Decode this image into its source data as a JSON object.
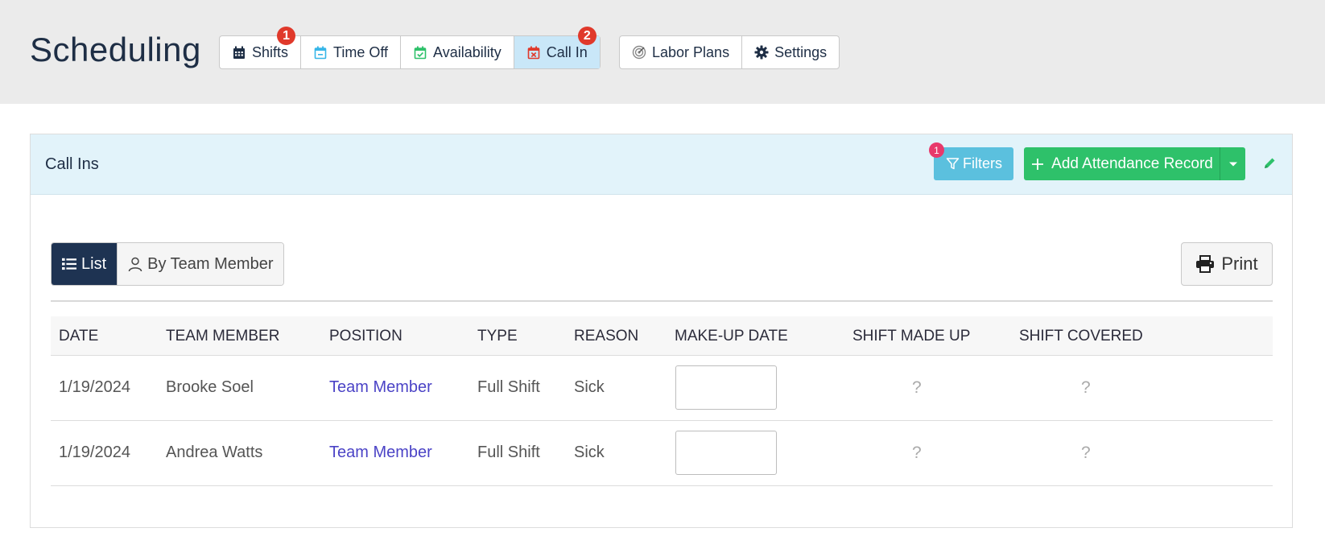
{
  "header": {
    "title": "Scheduling"
  },
  "nav": {
    "group1": [
      {
        "label": "Shifts",
        "badge": "1",
        "icon": "calendar-grid-icon",
        "color": "#1e2e45"
      },
      {
        "label": "Time Off",
        "badge": "",
        "icon": "calendar-minus-icon",
        "color": "#37b6e8"
      },
      {
        "label": "Availability",
        "badge": "",
        "icon": "calendar-check-icon",
        "color": "#2ec16a"
      },
      {
        "label": "Call In",
        "badge": "2",
        "icon": "calendar-x-icon",
        "color": "#e0392b",
        "active": true
      }
    ],
    "group2": [
      {
        "label": "Labor Plans",
        "icon": "target-icon"
      },
      {
        "label": "Settings",
        "icon": "gear-icon"
      }
    ]
  },
  "panel": {
    "title": "Call Ins",
    "filters_label": "Filters",
    "filters_badge": "1",
    "add_label": "Add Attendance Record",
    "print_label": "Print",
    "views": [
      {
        "label": "List",
        "active": true
      },
      {
        "label": "By Team Member",
        "active": false
      }
    ]
  },
  "table": {
    "columns": [
      "DATE",
      "TEAM MEMBER",
      "POSITION",
      "TYPE",
      "REASON",
      "MAKE-UP DATE",
      "SHIFT MADE UP",
      "SHIFT COVERED"
    ],
    "rows": [
      {
        "date": "1/19/2024",
        "member": "Brooke Soel",
        "position": "Team Member",
        "type": "Full Shift",
        "reason": "Sick",
        "made_up": "?",
        "covered": "?"
      },
      {
        "date": "1/19/2024",
        "member": "Andrea Watts",
        "position": "Team Member",
        "type": "Full Shift",
        "reason": "Sick",
        "made_up": "?",
        "covered": "?"
      }
    ]
  },
  "colors": {
    "accent_green": "#2ec16a",
    "accent_blue": "#5bc0de",
    "link": "#4b43c6",
    "badge_red": "#e0392b",
    "active_tab": "#c9e7f8"
  }
}
